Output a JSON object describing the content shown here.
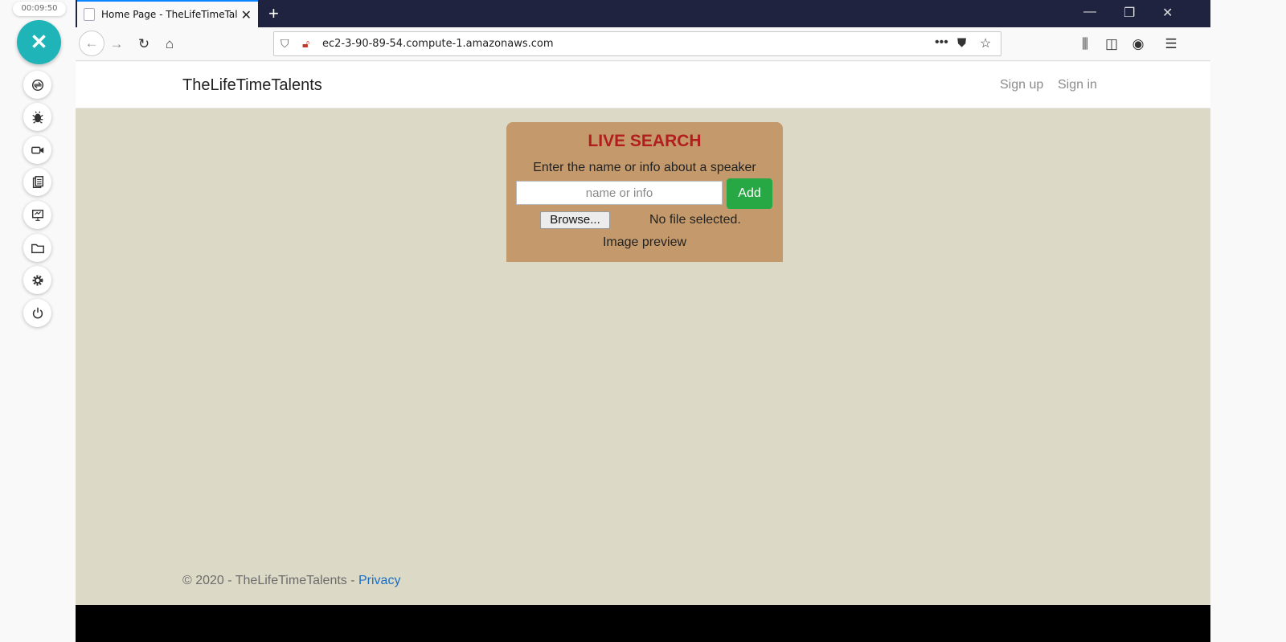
{
  "recorder": {
    "timer": "00:09:50",
    "tools": [
      "sync-icon",
      "bug-icon",
      "video-icon",
      "clipboard-icon",
      "presentation-icon",
      "folder-icon",
      "gear-icon",
      "power-icon"
    ]
  },
  "browser": {
    "tab_title": "Home Page - TheLifeTimeTalents",
    "url": "ec2-3-90-89-54.compute-1.amazonaws.com"
  },
  "site": {
    "brand": "TheLifeTimeTalents",
    "nav": {
      "signup": "Sign up",
      "signin": "Sign in"
    }
  },
  "search": {
    "title": "LIVE SEARCH",
    "hint": "Enter the name or info about a speaker",
    "placeholder": "name or info",
    "add_label": "Add",
    "browse_label": "Browse...",
    "file_status": "No file selected.",
    "preview_label": "Image preview"
  },
  "footer": {
    "copyright": "© 2020 - TheLifeTimeTalents - ",
    "privacy": "Privacy"
  },
  "colors": {
    "accent": "#1fb5b8",
    "page_bg": "#dcd9c6",
    "card_bg": "#c49a6c",
    "title_red": "#b21e1e",
    "add_green": "#28a745",
    "tabbar": "#202340"
  }
}
